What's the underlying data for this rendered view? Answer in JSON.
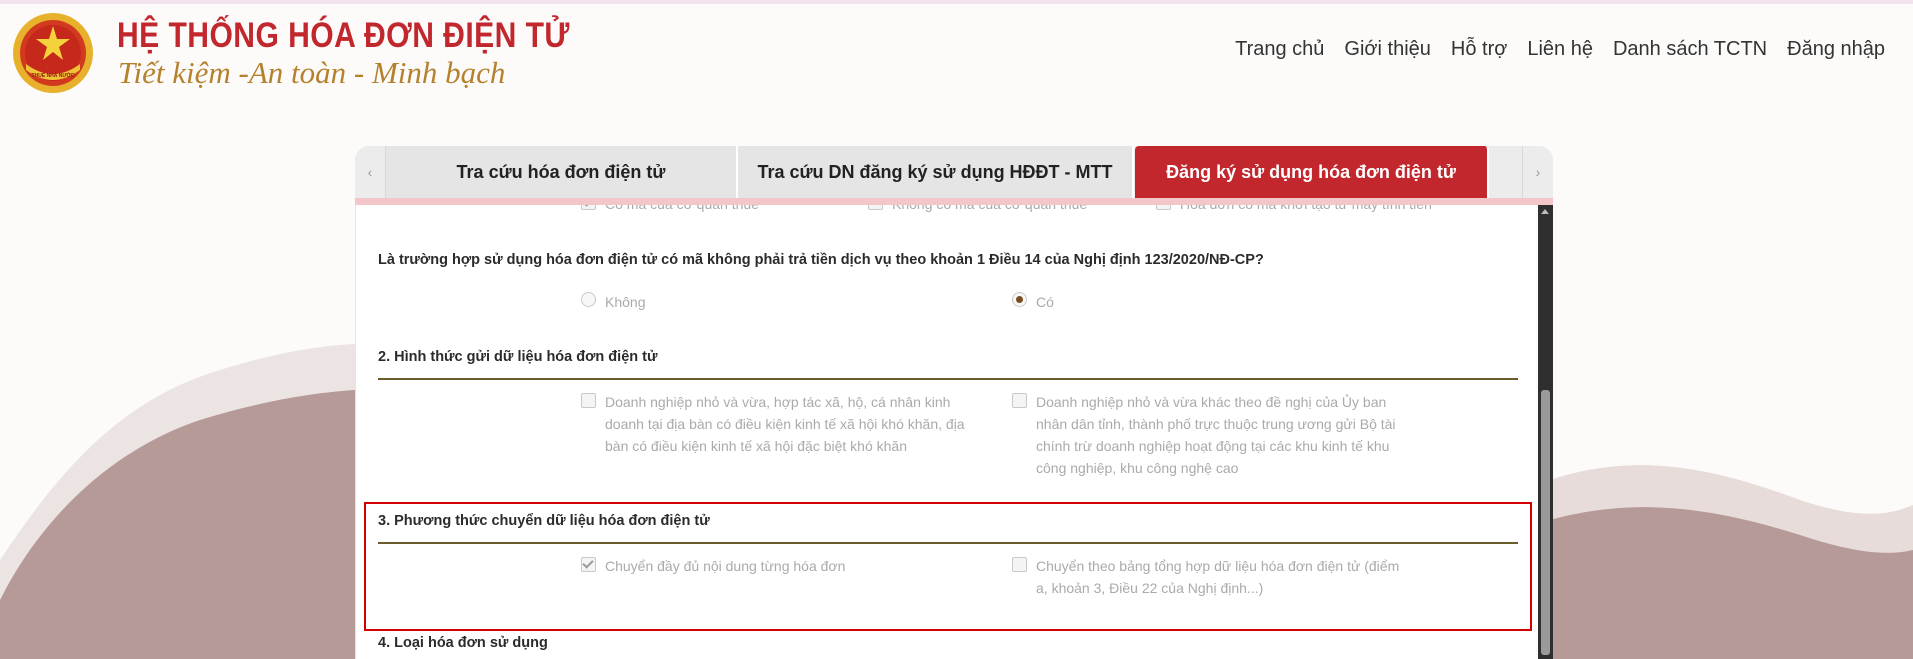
{
  "brand": {
    "title": "HỆ THỐNG HÓA ĐƠN ĐIỆN TỬ",
    "slogan": "Tiết kiệm -An toàn - Minh bạch",
    "logo_text": "THUẾ NHÀ NƯỚC"
  },
  "nav": {
    "items": [
      "Trang chủ",
      "Giới thiệu",
      "Hỗ trợ",
      "Liên hệ",
      "Danh sách TCTN",
      "Đăng nhập"
    ]
  },
  "tabs": {
    "prev_arrow": "‹",
    "next_arrow": "›",
    "items": [
      {
        "label": "Tra cứu hóa đơn điện tử",
        "active": false
      },
      {
        "label": "Tra cứu DN đăng ký sử dụng HĐĐT - MTT",
        "active": false
      },
      {
        "label": "Đăng ký sử dụng hóa đơn điện tử",
        "active": true
      }
    ]
  },
  "form": {
    "top_options": [
      {
        "label": "Có mã của cơ quan thuế",
        "checked": true
      },
      {
        "label": "Không có mã của cơ quan thuế",
        "checked": false
      },
      {
        "label": "Hóa đơn có mã khởi tạo từ máy tính tiền",
        "checked": false
      }
    ],
    "question": "Là trường hợp sử dụng hóa đơn điện tử có mã không phải trả tiền dịch vụ theo khoản 1 Điều 14 của Nghị định 123/2020/NĐ-CP?",
    "radio_options": [
      {
        "label": "Không",
        "checked": false
      },
      {
        "label": "Có",
        "checked": true
      }
    ],
    "section2": {
      "title": "2. Hình thức gửi dữ liệu hóa đơn điện tử",
      "options": [
        {
          "label": "Doanh nghiệp nhỏ và vừa, hợp tác xã, hộ, cá nhân kinh doanh tại địa bàn có điều kiện kinh tế xã hội khó khăn, địa bàn có điều kiện kinh tế xã hội đặc biệt khó khăn",
          "checked": false
        },
        {
          "label": "Doanh nghiệp nhỏ và vừa khác theo đề nghị của Ủy ban nhân dân tỉnh, thành phố trực thuộc trung ương gửi Bộ tài chính trừ doanh nghiệp hoạt động tại các khu kinh tế khu công nghiệp, khu công nghệ cao",
          "checked": false
        }
      ]
    },
    "section3": {
      "title": "3. Phương thức chuyển dữ liệu hóa đơn điện tử",
      "options": [
        {
          "label": "Chuyển đầy đủ nội dung từng hóa đơn",
          "checked": true
        },
        {
          "label": "Chuyển theo bảng tổng hợp dữ liệu hóa đơn điện tử (điểm a, khoản 3, Điều 22 của Nghị định...)",
          "checked": false
        }
      ]
    },
    "section4": {
      "title": "4. Loại hóa đơn sử dụng"
    }
  },
  "colors": {
    "brand_red": "#c1272d",
    "brand_gold": "#b5812d",
    "section_line": "#6b5b2a",
    "highlight": "#d40000",
    "wave": "#b59a98"
  }
}
